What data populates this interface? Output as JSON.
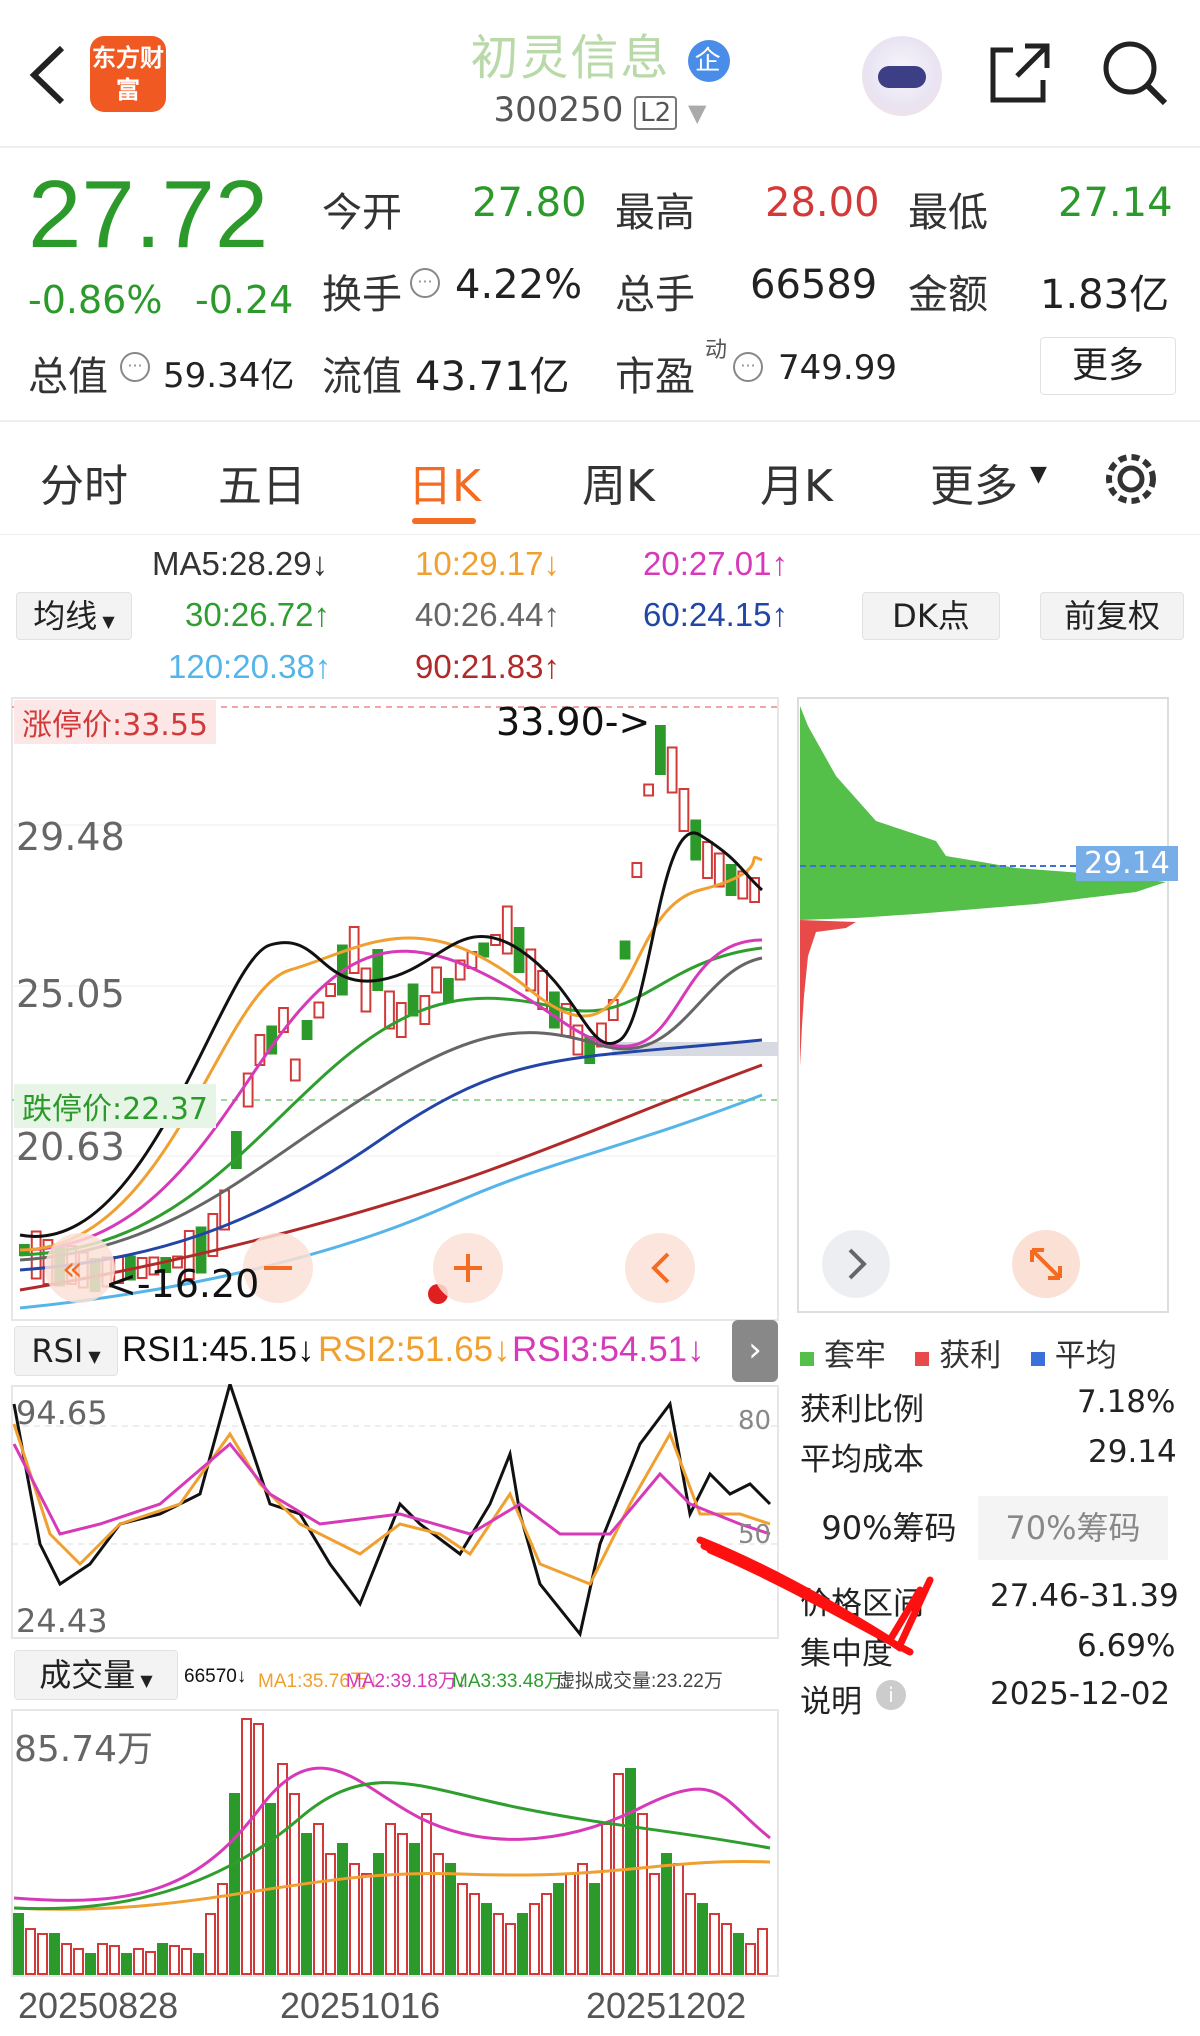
{
  "header": {
    "back_icon": "chevron-left-icon",
    "logo": "东方财富",
    "title": "初灵信息",
    "enterprise_badge": "企",
    "code": "300250",
    "level": "L2",
    "robot_icon": "robot-icon",
    "share_icon": "share-icon",
    "search_icon": "search-icon"
  },
  "quote": {
    "price": "27.72",
    "change_pct": "-0.86%",
    "change": "-0.24",
    "open_label": "今开",
    "open": "27.80",
    "high_label": "最高",
    "high": "28.00",
    "low_label": "最低",
    "low": "27.14",
    "turnover_label": "换手",
    "turnover": "4.22%",
    "volume_label": "总手",
    "volume": "66589",
    "amount_label": "金额",
    "amount": "1.83亿",
    "mktcap_label": "总值",
    "mktcap": "59.34亿",
    "float_label": "流值",
    "float": "43.71亿",
    "pe_label": "市盈",
    "pe_sup": "动",
    "pe": "749.99",
    "more": "更多"
  },
  "tabs": [
    "分时",
    "五日",
    "日K",
    "周K",
    "月K",
    "更多"
  ],
  "active_tab": "日K",
  "ma": {
    "selector": "均线",
    "ma5": "MA5:28.29↓",
    "ma10": "10:29.17↓",
    "ma20": "20:27.01↑",
    "ma30": "30:26.72↑",
    "ma40": "40:26.44↑",
    "ma60": "60:24.15↑",
    "ma120": "120:20.38↑",
    "ma90": "90:21.83↑",
    "dk": "DK点",
    "adjust": "前复权"
  },
  "chart": {
    "limit_up": "涨停价:33.55",
    "limit_down": "跌停价:22.37",
    "high_marker": "33.90->",
    "low_marker": "<-16.20",
    "y_labels": [
      "29.48",
      "25.05",
      "20.63"
    ],
    "last_price_tag": "29.14"
  },
  "rsi": {
    "selector": "RSI",
    "rsi1": "RSI1:45.15↓",
    "rsi2": "RSI2:51.65↓",
    "rsi3": "RSI3:54.51↓",
    "top": "94.65",
    "bottom": "24.43",
    "level80": "80",
    "level50": "50"
  },
  "volume": {
    "selector": "成交量",
    "vol": "66570↓",
    "ma1": "MA1:35.76万↓",
    "ma2": "MA2:39.18万↓",
    "ma3": "MA3:33.48万↓",
    "virtual": "虚拟成交量:23.22万",
    "top": "85.74万"
  },
  "dates": [
    "20250828",
    "20251016",
    "20251202"
  ],
  "chip": {
    "legend": [
      "套牢",
      "获利",
      "平均"
    ],
    "profit_label": "获利比例",
    "profit": "7.18%",
    "avg_label": "平均成本",
    "avg": "29.14",
    "tab90": "90%筹码",
    "tab70": "70%筹码",
    "range_label": "价格区间",
    "range": "27.46-31.39",
    "conc_label": "集中度",
    "conc": "6.69%",
    "note_label": "说明",
    "note": "2025-12-02"
  },
  "colors": {
    "up": "#d23a3a",
    "down": "#2b9a2b",
    "accent": "#f36c21"
  }
}
